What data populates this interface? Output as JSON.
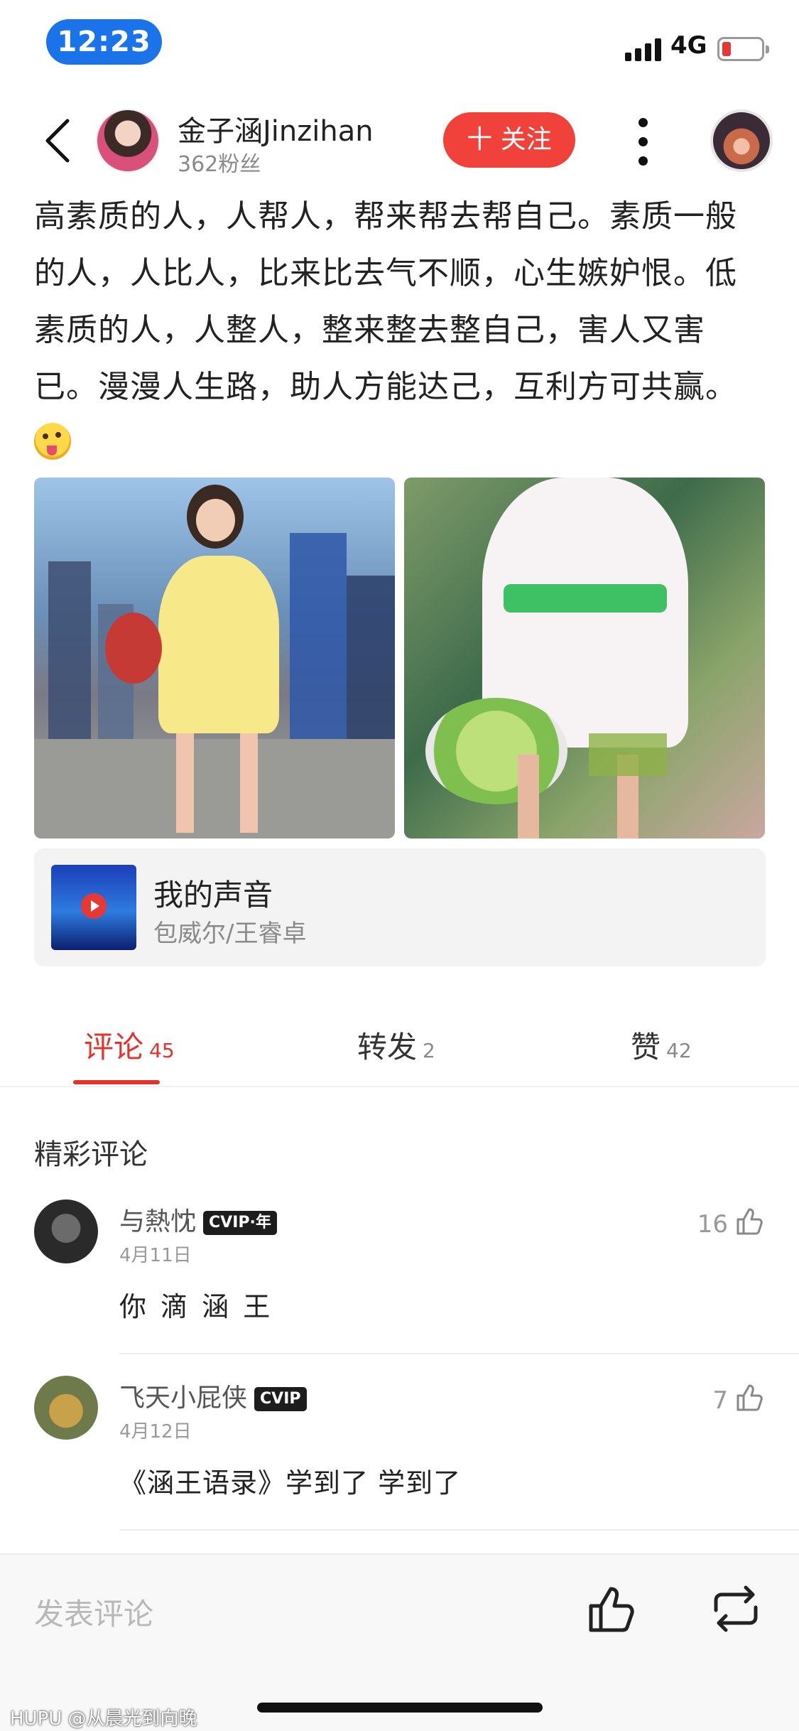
{
  "status_bar": {
    "time": "12:23",
    "network": "4G",
    "battery_color": "#e53935"
  },
  "header": {
    "user_name": "金子涵Jinzihan",
    "fans": "362粉丝",
    "follow_label": "十 关注",
    "accent": "#f0413a"
  },
  "post": {
    "text": "高素质的人，人帮人，帮来帮去帮自己。素质一般的人，人比人，比来比去气不顺，心生嫉妒恨。低素质的人，人整人，整来整去整自己，害人又害已。漫漫人生路，助人方能达己，互利方可共赢。",
    "emoji": "winking-tongue-emoji"
  },
  "music": {
    "title": "我的声音",
    "artist": "包威尔/王睿卓"
  },
  "tabs": [
    {
      "label": "评论",
      "count": "45"
    },
    {
      "label": "转发",
      "count": "2"
    },
    {
      "label": "赞",
      "count": "42"
    }
  ],
  "section_title": "精彩评论",
  "comments": [
    {
      "user": "与熱忱",
      "badge": "CVIP·年",
      "date": "4月11日",
      "likes": "16",
      "text": "你 滴 涵 王"
    },
    {
      "user": "飞天小屁侠",
      "badge": "CVIP",
      "date": "4月12日",
      "likes": "7",
      "text": "《涵王语录》学到了 学到了"
    }
  ],
  "bottom_bar": {
    "placeholder": "发表评论",
    "watermark": "HUPU @从晨光到向晚"
  }
}
